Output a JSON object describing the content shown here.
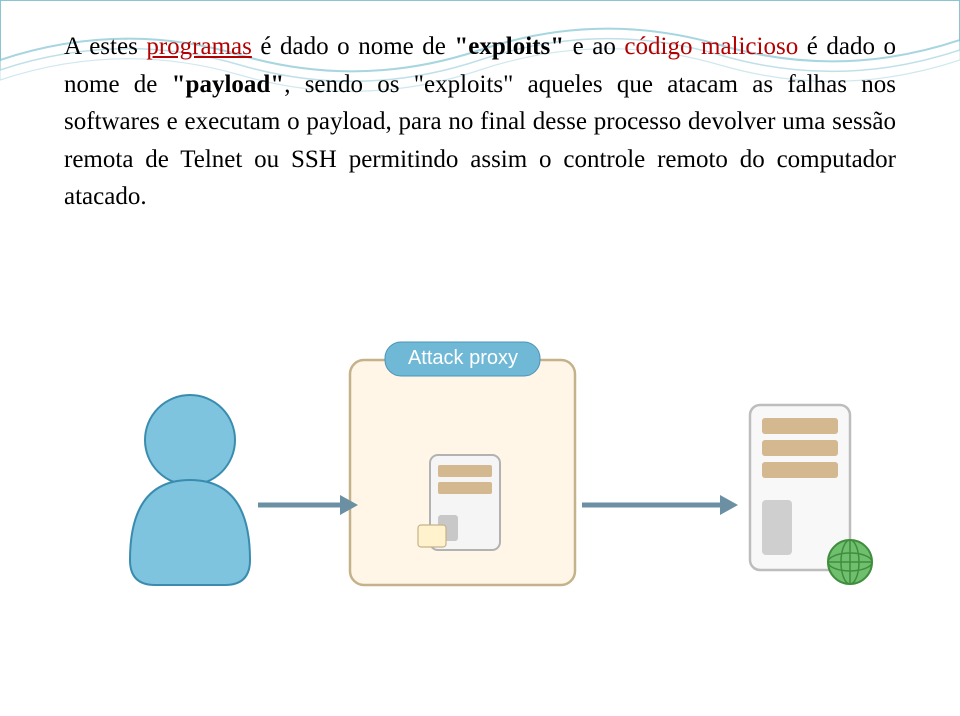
{
  "text": {
    "p1_a": "A estes ",
    "p1_b": "programas",
    "p1_c": " é dado o nome de ",
    "p1_d": "\"exploits\"",
    "p1_e": " e ao ",
    "p1_f": "código malicioso",
    "p1_g": " é dado o nome de ",
    "p1_h": "\"payload\"",
    "p1_i": ", sendo os \"exploits\" aqueles que atacam as falhas nos softwares e executam o payload, para no final desse processo devolver uma sessão remota de Telnet ou SSH  permitindo assim o controle remoto do computador atacado."
  },
  "diagram": {
    "proxy_label": "Attack proxy"
  }
}
